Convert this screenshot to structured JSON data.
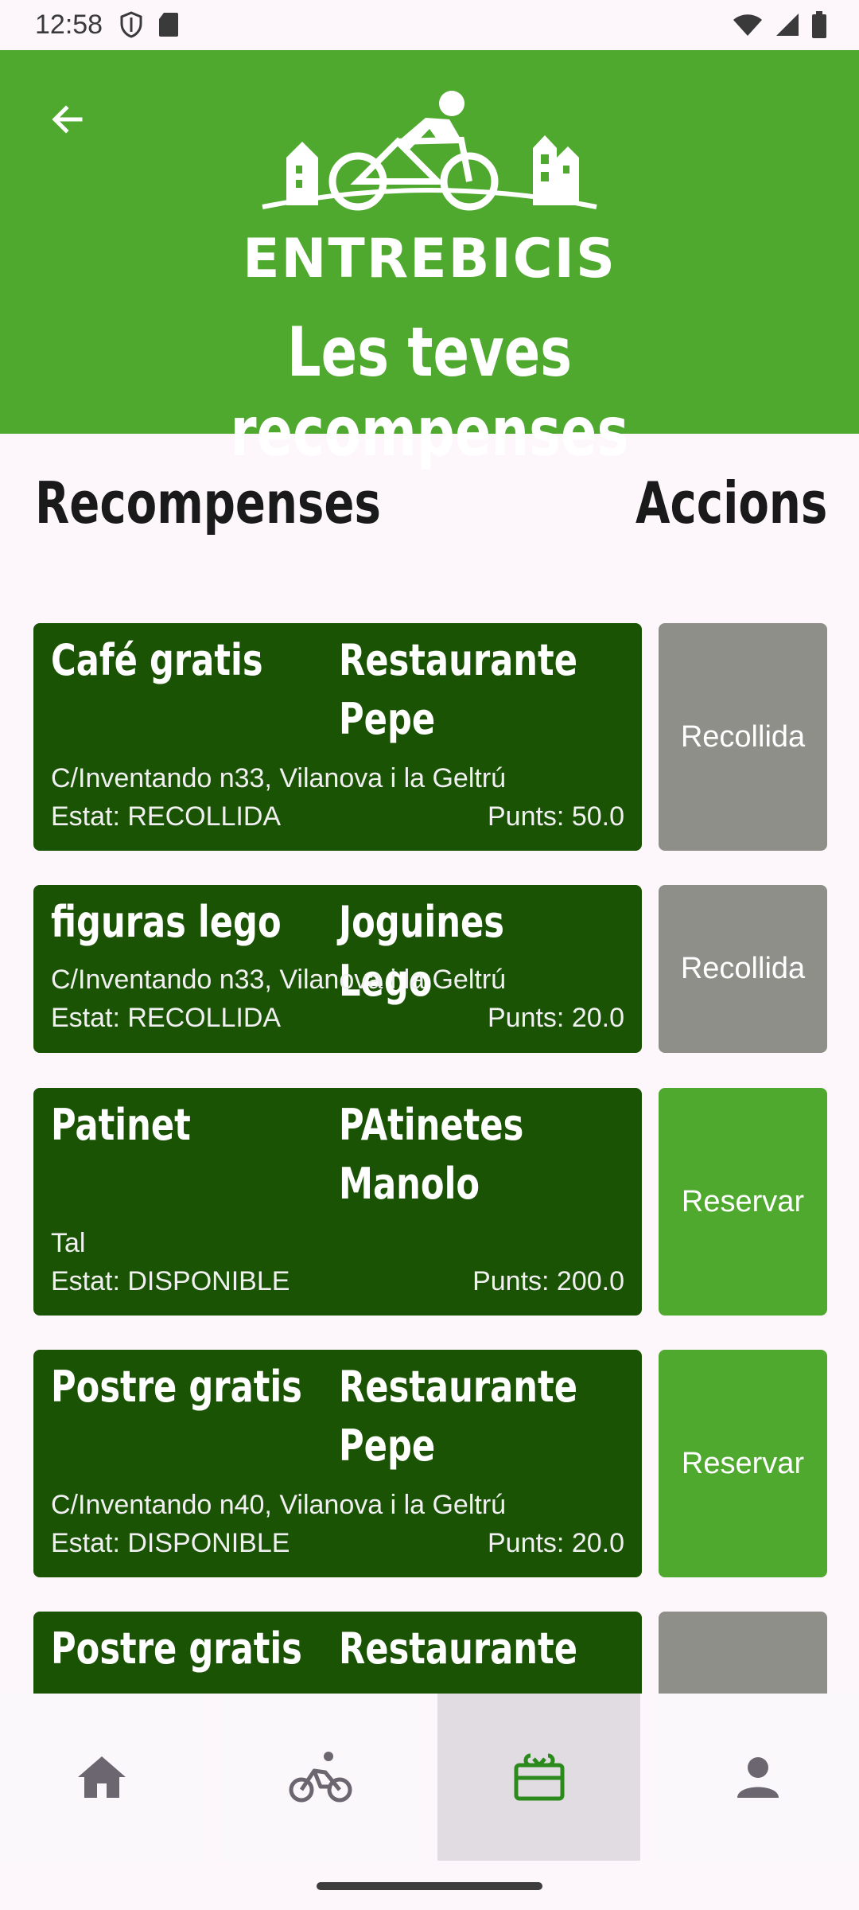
{
  "status_bar": {
    "time": "12:58"
  },
  "header": {
    "logo_text": "ENTREBICIS",
    "title": "Les teves recompenses"
  },
  "columns": {
    "rewards": "Recompenses",
    "actions": "Accions"
  },
  "rewards": [
    {
      "name": "Café gratis",
      "shop": "Restaurante Pepe",
      "address": "C/Inventando n33, Vilanova i la Geltrú",
      "status": "Estat: RECOLLIDA",
      "points": "Punts: 50.0",
      "action": "Recollida"
    },
    {
      "name": "figuras lego",
      "shop": "Joguines Lego",
      "address": "C/Inventando n33, Vilanova i la Geltrú",
      "status": "Estat: RECOLLIDA",
      "points": "Punts: 20.0",
      "action": "Recollida"
    },
    {
      "name": "Patinet",
      "shop": "PAtinetes Manolo",
      "address": "Tal",
      "status": "Estat: DISPONIBLE",
      "points": "Punts: 200.0",
      "action": "Reservar"
    },
    {
      "name": "Postre gratis",
      "shop": "Restaurante Pepe",
      "address": "C/Inventando n40, Vilanova i la Geltrú",
      "status": "Estat: DISPONIBLE",
      "points": "Punts: 20.0",
      "action": "Reservar"
    },
    {
      "name": "Postre gratis",
      "shop": "Restaurante",
      "address": "",
      "status": "",
      "points": "",
      "action": ""
    }
  ],
  "colors": {
    "brand_green": "#50a92f",
    "card_dark_green": "#1b5305",
    "collected_gray": "#8f8f8a"
  },
  "nav": [
    {
      "icon": "home-icon"
    },
    {
      "icon": "bike-icon"
    },
    {
      "icon": "gift-icon",
      "active": true
    },
    {
      "icon": "person-icon"
    }
  ]
}
